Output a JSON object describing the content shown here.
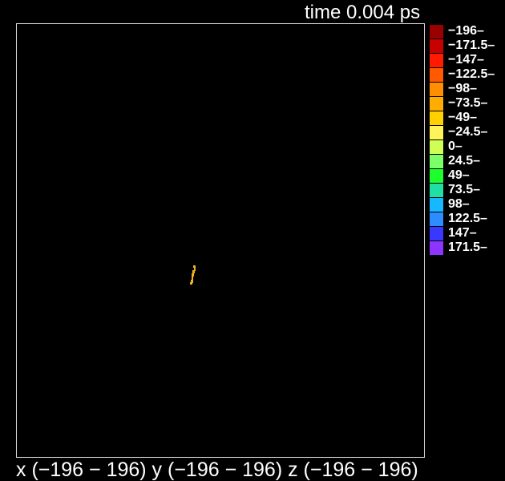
{
  "header": {
    "time_label": "time 0.004 ps"
  },
  "footer": {
    "range_label": "x (−196 − 196) y (−196 − 196) z (−196 − 196)"
  },
  "colors": {
    "background": "#000000",
    "frame_border": "#d8d8d8",
    "text": "#ffffff",
    "particle": "#f3b21b"
  },
  "legend": {
    "items": [
      {
        "label": "−196–",
        "color": "#9b0000"
      },
      {
        "label": "−171.5–",
        "color": "#c80000"
      },
      {
        "label": "−147–",
        "color": "#ff1a00"
      },
      {
        "label": "−122.5–",
        "color": "#ff5a00"
      },
      {
        "label": "−98–",
        "color": "#ff8f00"
      },
      {
        "label": "−73.5–",
        "color": "#ffad00"
      },
      {
        "label": "−49–",
        "color": "#ffd000"
      },
      {
        "label": "−24.5–",
        "color": "#fff35a"
      },
      {
        "label": "0–",
        "color": "#cfff55"
      },
      {
        "label": "24.5–",
        "color": "#7dff6a"
      },
      {
        "label": "49–",
        "color": "#1dff2d"
      },
      {
        "label": "73.5–",
        "color": "#20dfa5"
      },
      {
        "label": "98–",
        "color": "#17b8ff"
      },
      {
        "label": "122.5–",
        "color": "#2d8cff"
      },
      {
        "label": "147–",
        "color": "#3838ff"
      },
      {
        "label": "171.5–",
        "color": "#8d35ff"
      }
    ]
  }
}
